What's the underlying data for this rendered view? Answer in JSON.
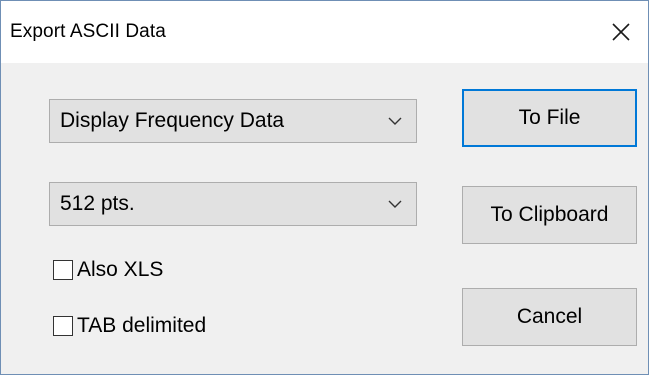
{
  "window": {
    "title": "Export ASCII Data",
    "close_icon": "close-icon"
  },
  "data_type": {
    "selected": "Display Frequency Data"
  },
  "points": {
    "selected": "512 pts."
  },
  "options": {
    "also_xls": {
      "label": "Also XLS",
      "checked": false
    },
    "tab_delimited": {
      "label": "TAB delimited",
      "checked": false
    }
  },
  "buttons": {
    "to_file": "To File",
    "to_clipboard": "To Clipboard",
    "cancel": "Cancel"
  },
  "colors": {
    "dialog_bg": "#f0f0f0",
    "default_button_border": "#0078d7"
  }
}
